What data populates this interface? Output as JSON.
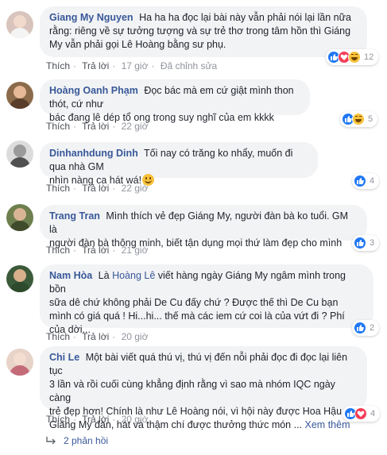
{
  "comments": [
    {
      "name": "Giang My Nguyen",
      "lines": [
        "Ha ha ha đọc lại bài này vẫn phải nói lại lần nữa",
        "rằng: riêng về sự tưởng tượng và sự trẻ thơ trong tâm hồn thì Giáng",
        "My vẫn phải gọi Lê Hoàng bằng sư phụ."
      ],
      "like": "Thích",
      "reply": "Trả lời",
      "time": "17 giờ",
      "edited": "Đã chỉnh sửa",
      "reactions": [
        "like",
        "love",
        "haha"
      ],
      "reaction_count": "12"
    },
    {
      "name": "Hoàng Oanh Phạm",
      "lines": [
        "Đọc bác mà em cứ giật mình thon thót, cứ như",
        "bác đang lê dép tổ ong trong suy nghĩ của em kkkk"
      ],
      "like": "Thích",
      "reply": "Trả lời",
      "time": "22 giờ",
      "reactions": [
        "like",
        "haha"
      ],
      "reaction_count": "5"
    },
    {
      "name": "Dinhanhdung Dinh",
      "lines": [
        "Tối nay có trăng ko nhẩy, muốn đi qua nhà GM",
        "nhìn nàng ca hát wá!"
      ],
      "like": "Thích",
      "reply": "Trả lời",
      "time": "22 giờ",
      "reactions": [
        "like"
      ],
      "reaction_count": "4"
    },
    {
      "name": "Trang Tran",
      "lines": [
        "Mình thích vẻ đẹp Giáng My, người đàn bà ko tuổi. GM là",
        "người đàn bà thông minh, biết tận dụng mọi thứ làm đẹp cho mình"
      ],
      "like": "Thích",
      "reply": "Trả lời",
      "time": "21 giờ",
      "reactions": [
        "like"
      ],
      "reaction_count": "3"
    },
    {
      "name": "Nam Hòa",
      "mention": "Hoàng Lê",
      "lines": [
        "Là",
        "viết hàng ngày Giáng My ngâm mình trong bồn",
        "sữa dê chứ không phải De Cu đấy chứ ? Được thế thì De Cu bạn",
        "mình có giá quá ! Hi...hi... thế mà các iem cứ coi là của vứt đi ? Phí",
        "của dời..."
      ],
      "like": "Thích",
      "reply": "Trả lời",
      "time": "20 giờ",
      "reactions": [
        "like"
      ],
      "reaction_count": "2"
    },
    {
      "name": "Chi Le",
      "lines": [
        "Một bài viết quá thú vị, thú vị đến nỗi phải đọc đi đọc lại liên tục",
        "3 lần và rồi cuối cùng khẳng định rằng vì sao mà nhóm IQC ngày càng",
        "trẻ đẹp hơn! Chính là như Lê Hoàng nói, vì hội này được Hoa Hậu",
        "Giáng My đàn, hát và thậm chí được thưởng thức món ..."
      ],
      "see_more": "Xem thêm",
      "like": "Thích",
      "reply": "Trả lời",
      "time": "20 giờ",
      "reactions": [
        "like",
        "love"
      ],
      "reaction_count": "4"
    }
  ],
  "replies_link": "2 phản hồi",
  "colors": {
    "link": "#385898",
    "bubble": "#f2f3f5",
    "like_blue": "#2078f4",
    "love_red": "#f33e58"
  }
}
